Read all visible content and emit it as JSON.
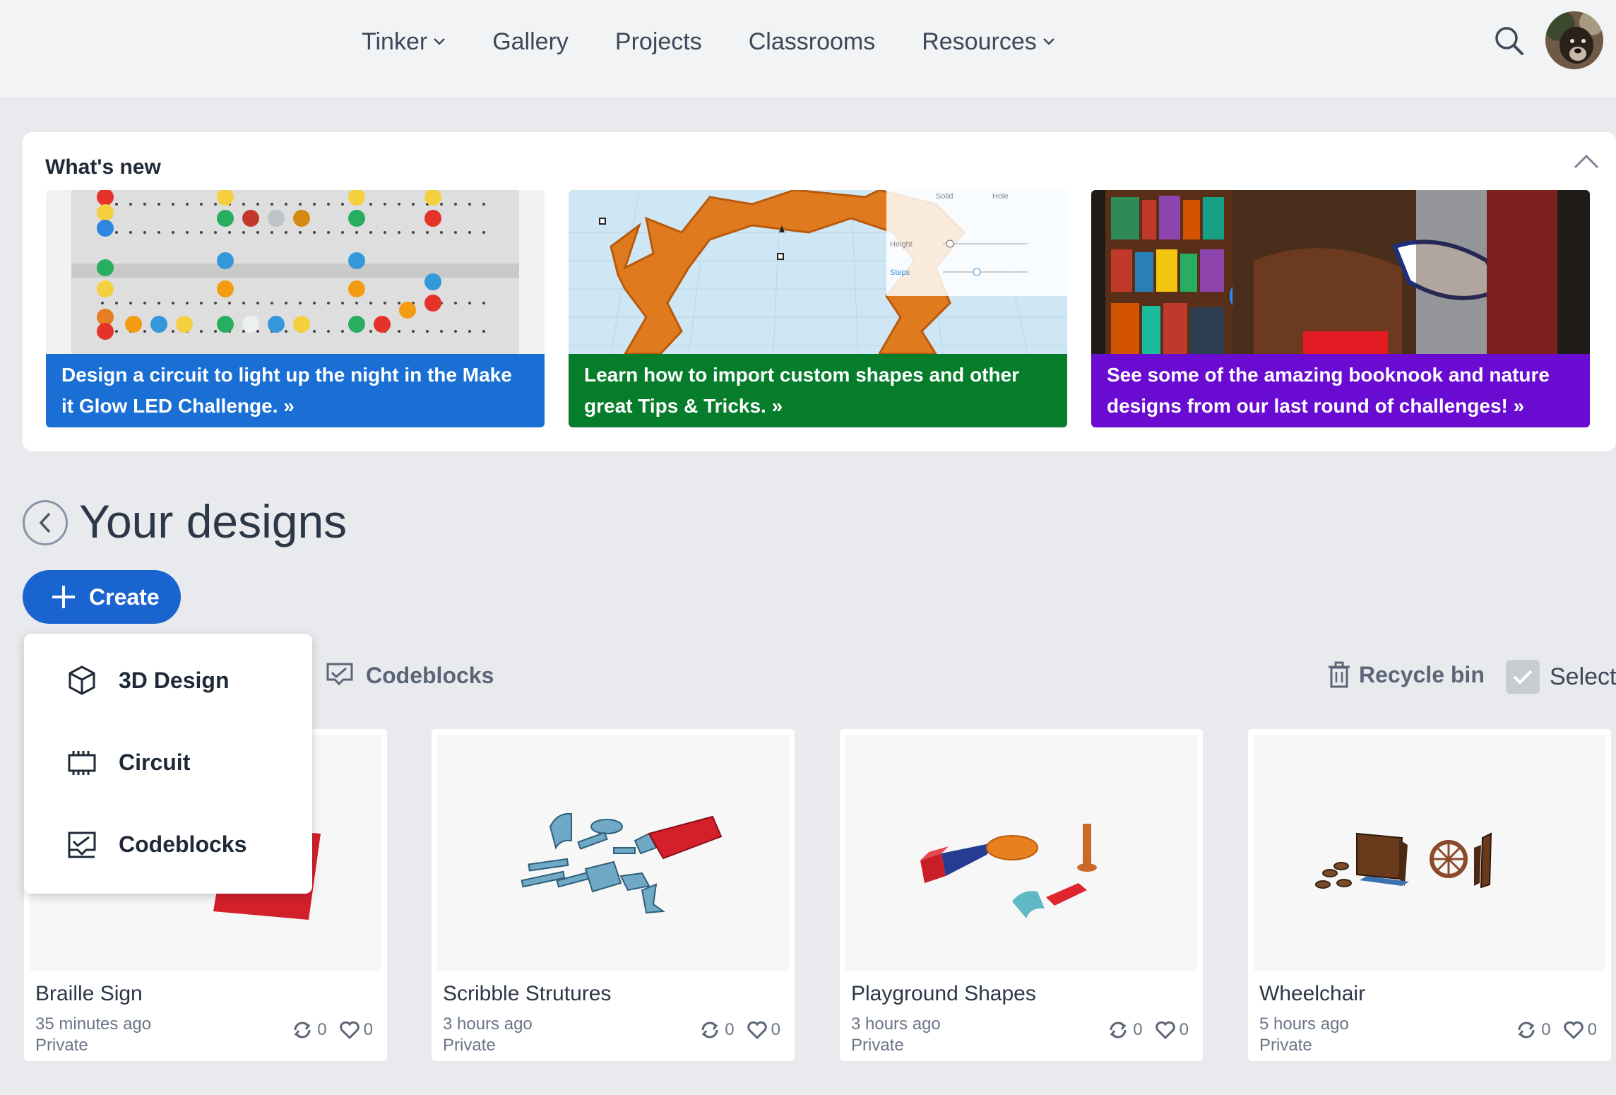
{
  "nav": {
    "items": [
      {
        "label": "Tinker",
        "dropdown": true
      },
      {
        "label": "Gallery",
        "dropdown": false
      },
      {
        "label": "Projects",
        "dropdown": false
      },
      {
        "label": "Classrooms",
        "dropdown": false
      },
      {
        "label": "Resources",
        "dropdown": true
      }
    ]
  },
  "whats_new": {
    "title": "What's new",
    "cards": [
      {
        "caption": "Design a circuit to light up the night in the Make it Glow LED Challenge. »",
        "color": "#1a6fd4"
      },
      {
        "caption": "Learn how to import custom shapes and other great Tips & Tricks. »",
        "color": "#067d2b"
      },
      {
        "caption": "See some of the amazing booknook and nature designs from our last round of challenges! »",
        "color": "#6a0bd1"
      }
    ]
  },
  "designs": {
    "title": "Your designs",
    "create_label": "Create",
    "filter_codeblocks": "Codeblocks",
    "recycle_bin": "Recycle bin",
    "select_label": "Select",
    "cards": [
      {
        "name": "Braille Sign",
        "time": "35 minutes ago",
        "privacy": "Private",
        "remixes": "0",
        "likes": "0"
      },
      {
        "name": "Scribble Strutures",
        "time": "3 hours ago",
        "privacy": "Private",
        "remixes": "0",
        "likes": "0"
      },
      {
        "name": "Playground Shapes",
        "time": "3 hours ago",
        "privacy": "Private",
        "remixes": "0",
        "likes": "0"
      },
      {
        "name": "Wheelchair",
        "time": "5 hours ago",
        "privacy": "Private",
        "remixes": "0",
        "likes": "0"
      }
    ]
  },
  "create_menu": {
    "items": [
      {
        "label": "3D Design",
        "icon": "cube-icon"
      },
      {
        "label": "Circuit",
        "icon": "chip-icon"
      },
      {
        "label": "Codeblocks",
        "icon": "codeblocks-icon"
      }
    ]
  },
  "colors": {
    "accent": "#1a64cf",
    "background": "#e8eaed"
  }
}
